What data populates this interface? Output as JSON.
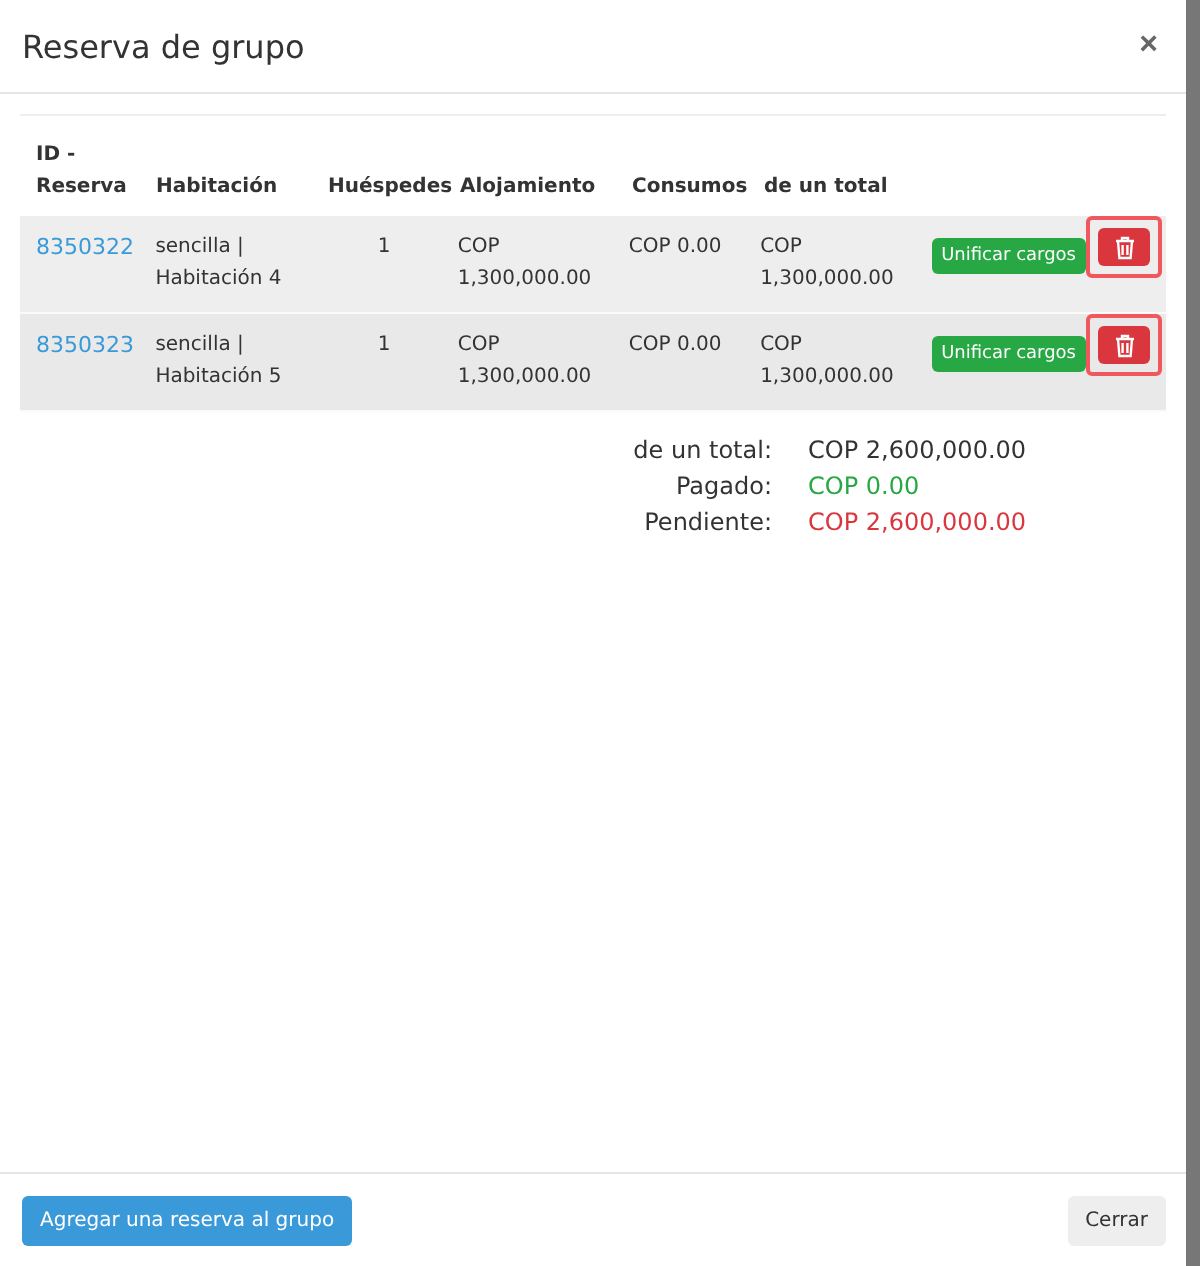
{
  "modal": {
    "title": "Reserva de grupo",
    "close": "×"
  },
  "table": {
    "columns": [
      "ID - Reserva",
      "Habitación",
      "Huéspedes",
      "Alojamiento",
      "Consumos",
      "de un total"
    ],
    "rows": [
      {
        "id": "8350322",
        "room": "sencilla | Habitación 4",
        "guests": "1",
        "lodging": "COP 1,300,000.00",
        "consumption": "COP 0.00",
        "total": "COP 1,300,000.00",
        "action": "Unificar cargos",
        "delete_highlighted": true
      },
      {
        "id": "8350323",
        "room": "sencilla | Habitación 5",
        "guests": "1",
        "lodging": "COP 1,300,000.00",
        "consumption": "COP 0.00",
        "total": "COP 1,300,000.00",
        "action": "Unificar cargos",
        "delete_highlighted": true
      }
    ]
  },
  "summary": [
    {
      "label": "de un total:",
      "value": "COP 2,600,000.00",
      "kind": "neutral"
    },
    {
      "label": "Pagado:",
      "value": "COP 0.00",
      "kind": "paid"
    },
    {
      "label": "Pendiente:",
      "value": "COP 2,600,000.00",
      "kind": "due"
    }
  ],
  "footer": {
    "add_button": "Agregar una reserva al grupo",
    "close_button": "Cerrar"
  }
}
